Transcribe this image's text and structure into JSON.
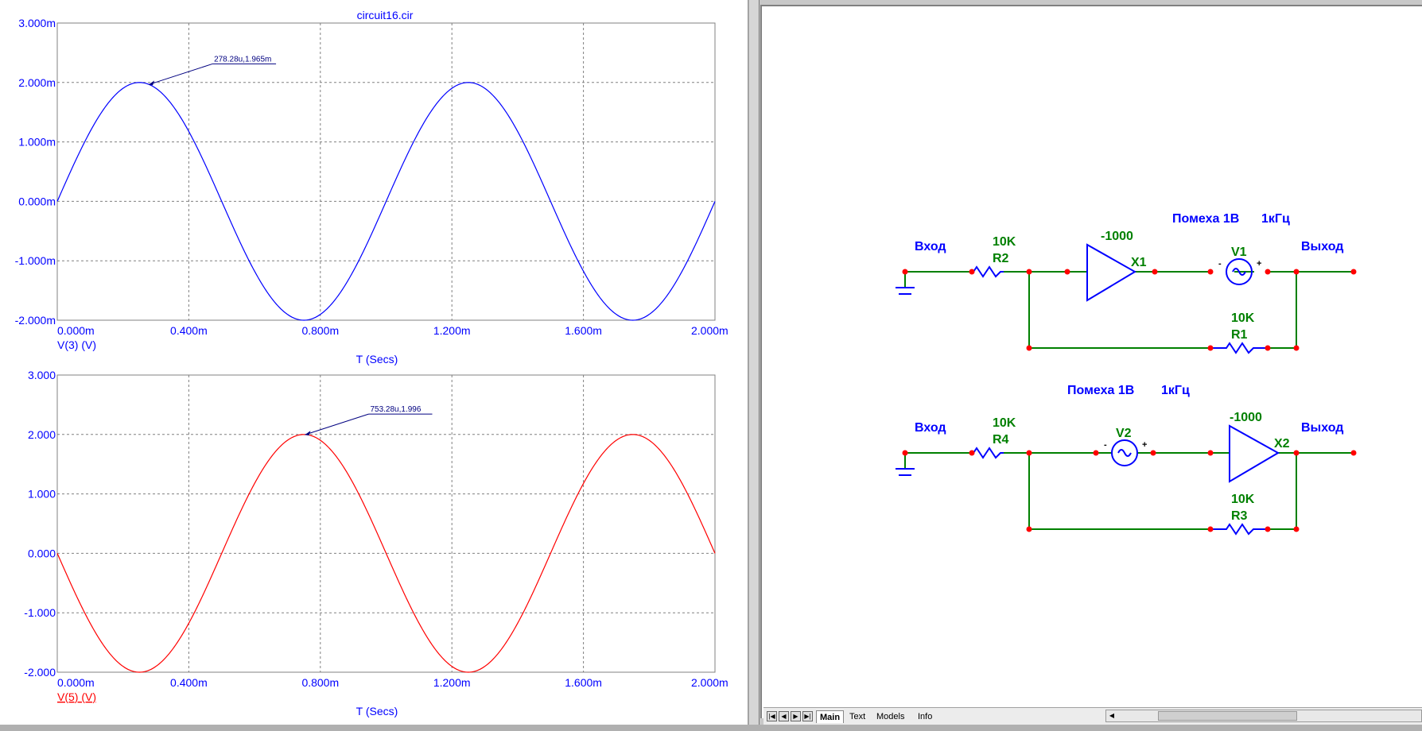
{
  "window": {
    "title": "circuit16.cir"
  },
  "plots": [
    {
      "y_ticks": [
        "3.000m",
        "2.000m",
        "1.000m",
        "0.000m",
        "-1.000m",
        "-2.000m"
      ],
      "x_ticks": [
        "0.000m",
        "0.400m",
        "0.800m",
        "1.200m",
        "1.600m",
        "2.000m"
      ],
      "trace_label": "V(3) (V)",
      "x_label": "T (Secs)",
      "cursor_label": "278.28u,1.965m",
      "color": "#0000ff"
    },
    {
      "y_ticks": [
        "3.000",
        "2.000",
        "1.000",
        "0.000",
        "-1.000",
        "-2.000"
      ],
      "x_ticks": [
        "0.000m",
        "0.400m",
        "0.800m",
        "1.200m",
        "1.600m",
        "2.000m"
      ],
      "trace_label": "V(5) (V)",
      "x_label": "T (Secs)",
      "cursor_label": "753.28u,1.996",
      "color": "#ff0000"
    }
  ],
  "chart_data": [
    {
      "type": "line",
      "ylim": [
        -2,
        3
      ],
      "xlim": [
        0,
        2
      ],
      "series": [
        {
          "name": "V(3) (V)",
          "x": [
            0,
            0.125,
            0.25,
            0.375,
            0.5,
            0.625,
            0.75,
            0.875,
            1.0,
            1.125,
            1.25,
            1.375,
            1.5,
            1.625,
            1.75,
            1.875,
            2.0
          ],
          "y": [
            0,
            1.414,
            2,
            1.414,
            0,
            -1.414,
            -2,
            -1.414,
            0,
            1.414,
            2,
            1.414,
            0,
            -1.414,
            -2,
            -1.414,
            0
          ]
        }
      ],
      "cursor": {
        "x": 0.27828,
        "y": 1.965
      }
    },
    {
      "type": "line",
      "ylim": [
        -2,
        3
      ],
      "xlim": [
        0,
        2
      ],
      "series": [
        {
          "name": "V(5) (V)",
          "x": [
            0,
            0.125,
            0.25,
            0.375,
            0.5,
            0.625,
            0.75,
            0.875,
            1.0,
            1.125,
            1.25,
            1.375,
            1.5,
            1.625,
            1.75,
            1.875,
            2.0
          ],
          "y": [
            0,
            -1.414,
            -2,
            -1.414,
            0,
            1.414,
            2,
            1.414,
            0,
            -1.414,
            -2,
            -1.414,
            0,
            1.414,
            2,
            1.414,
            0
          ]
        }
      ],
      "cursor": {
        "x": 0.75328,
        "y": 1.996
      }
    }
  ],
  "schematic": {
    "colors": {
      "wire": "#008000",
      "label": "#0000ff",
      "value": "#008000",
      "node": "#ff0000",
      "part": "#0000ff"
    },
    "c1": {
      "in_label": "Вход",
      "out_label": "Выход",
      "r2_value": "10K",
      "r2_name": "R2",
      "gain": "-1000",
      "amp_name": "X1",
      "noise_label": "Помеха 1В",
      "freq_label": "1кГц",
      "v_name": "V1",
      "r1_value": "10K",
      "r1_name": "R1"
    },
    "c2": {
      "in_label": "Вход",
      "out_label": "Выход",
      "r4_value": "10K",
      "r4_name": "R4",
      "noise_label": "Помеха 1В",
      "freq_label": "1кГц",
      "v_name": "V2",
      "gain": "-1000",
      "amp_name": "X2",
      "r3_value": "10K",
      "r3_name": "R3"
    }
  },
  "tabs": [
    "Main",
    "Text",
    "Models",
    "Info"
  ],
  "nav_icons": [
    "first-icon",
    "prev-icon",
    "next-icon",
    "last-icon"
  ]
}
